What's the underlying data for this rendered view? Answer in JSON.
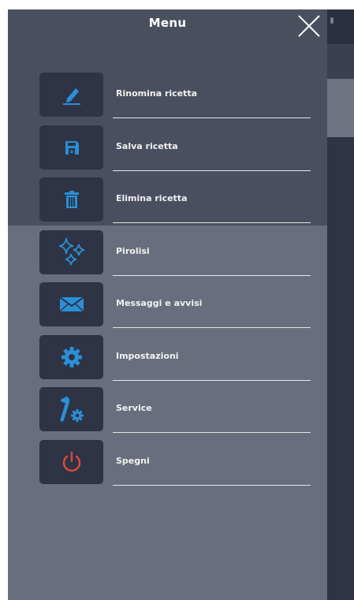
{
  "menu": {
    "title": "Menu",
    "items": [
      {
        "label": "Rinomina ricetta",
        "icon": "pencil-icon"
      },
      {
        "label": "Salva ricetta",
        "icon": "save-icon"
      },
      {
        "label": "Elimina ricetta",
        "icon": "trash-icon"
      },
      {
        "label": "Pirolisi",
        "icon": "sparkle-icon"
      },
      {
        "label": "Messaggi e avvisi",
        "icon": "envelope-icon"
      },
      {
        "label": "Impostazioni",
        "icon": "gear-icon"
      },
      {
        "label": "Service",
        "icon": "wrench-gear-icon"
      },
      {
        "label": "Spegni",
        "icon": "power-icon"
      }
    ]
  },
  "colors": {
    "accent": "#2b8fd6",
    "power": "#e0493c",
    "icon_box": "#2e3345",
    "drawer_top": "#4a4f60",
    "drawer_bottom": "#686e7e"
  }
}
